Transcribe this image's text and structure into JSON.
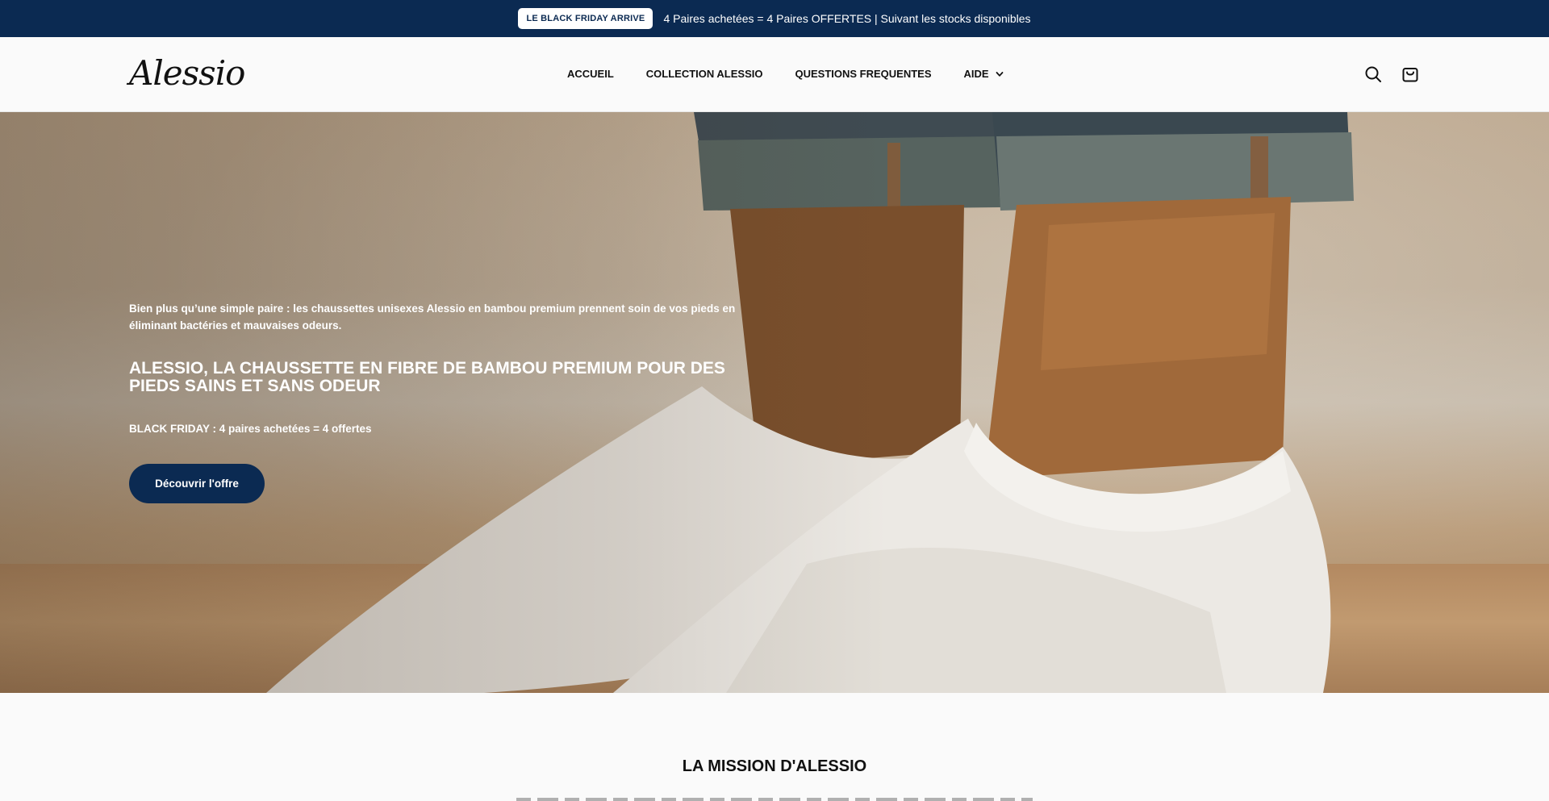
{
  "announcement": {
    "badge": "LE BLACK FRIDAY ARRIVE",
    "message": "4 Paires achetées = 4 Paires OFFERTES | Suivant les stocks disponibles"
  },
  "header": {
    "logo": "Alessio",
    "nav": [
      {
        "label": "ACCUEIL"
      },
      {
        "label": "COLLECTION ALESSIO"
      },
      {
        "label": "QUESTIONS FREQUENTES"
      },
      {
        "label": "AIDE"
      }
    ],
    "icons": [
      "search-icon",
      "cart-icon"
    ]
  },
  "hero": {
    "subtitle": "Bien plus qu’une simple paire : les chaussettes unisexes Alessio en bambou premium prennent soin de vos pieds en éliminant bactéries et mauvaises odeurs.",
    "title": "ALESSIO, LA CHAUSSETTE EN FIBRE DE BAMBOU PREMIUM POUR DES PIEDS SAINS ET SANS ODEUR",
    "offer": "BLACK FRIDAY : 4 paires achetées = 4 offertes",
    "cta": "Découvrir l'offre"
  },
  "mission": {
    "title": "LA MISSION D'ALESSIO"
  },
  "colors": {
    "brand_navy": "#0b2a52",
    "background": "#fafafa",
    "hero_text": "#ffffff"
  }
}
